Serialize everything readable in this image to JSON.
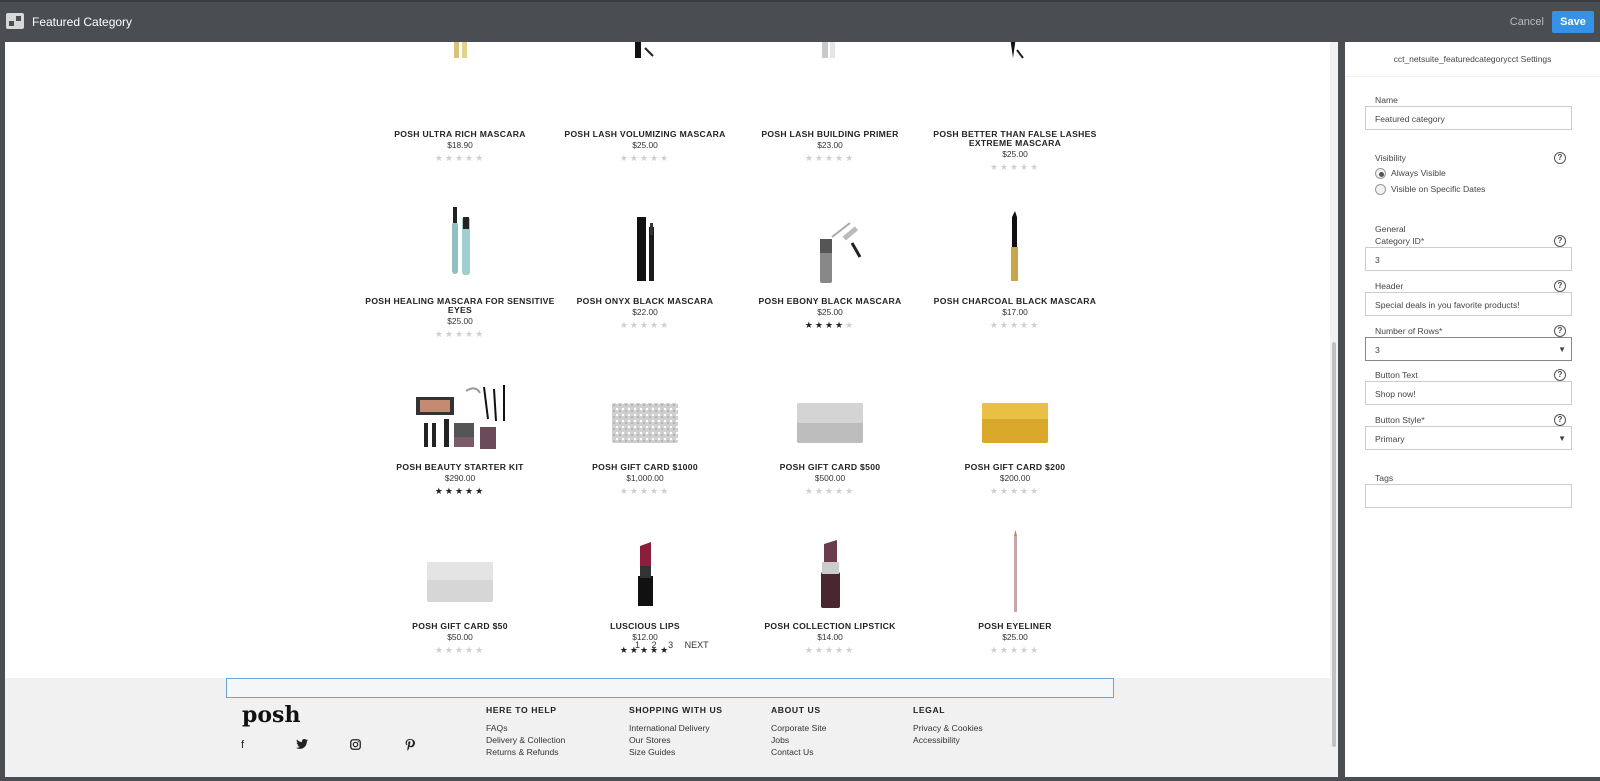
{
  "topbar": {
    "title": "Featured Category",
    "cancel": "Cancel",
    "save": "Save"
  },
  "products": [
    {
      "name": "POSH ULTRA RICH MASCARA",
      "price": "$18.90",
      "rating": 0,
      "img": "mascara-gold"
    },
    {
      "name": "POSH LASH VOLUMIZING MASCARA",
      "price": "$25.00",
      "rating": 0,
      "img": "mascara-black"
    },
    {
      "name": "POSH LASH BUILDING PRIMER",
      "price": "$23.00",
      "rating": 0,
      "img": "primer-silver"
    },
    {
      "name": "POSH BETTER THAN FALSE LASHES EXTREME MASCARA",
      "price": "$25.00",
      "rating": 0,
      "img": "mascara-wand"
    },
    {
      "name": "POSH HEALING MASCARA FOR SENSITIVE EYES",
      "price": "$25.00",
      "rating": 0,
      "img": "mascara-teal"
    },
    {
      "name": "POSH ONYX BLACK MASCARA",
      "price": "$22.00",
      "rating": 0,
      "img": "mascara-onyx"
    },
    {
      "name": "POSH EBONY BLACK MASCARA",
      "price": "$25.00",
      "rating": 4,
      "img": "mascara-ebony"
    },
    {
      "name": "POSH CHARCOAL BLACK MASCARA",
      "price": "$17.00",
      "rating": 0,
      "img": "mascara-charcoal"
    },
    {
      "name": "POSH BEAUTY STARTER KIT",
      "price": "$290.00",
      "rating": 5,
      "img": "starter-kit"
    },
    {
      "name": "POSH GIFT CARD $1000",
      "price": "$1,000.00",
      "rating": 0,
      "img": "card-diamond"
    },
    {
      "name": "POSH GIFT CARD $500",
      "price": "$500.00",
      "rating": 0,
      "img": "card-platinum"
    },
    {
      "name": "POSH GIFT CARD $200",
      "price": "$200.00",
      "rating": 0,
      "img": "card-gold"
    },
    {
      "name": "POSH GIFT CARD $50",
      "price": "$50.00",
      "rating": 0,
      "img": "card-silver"
    },
    {
      "name": "LUSCIOUS LIPS",
      "price": "$12.00",
      "rating": 4.5,
      "img": "lipstick-red"
    },
    {
      "name": "POSH COLLECTION LIPSTICK",
      "price": "$14.00",
      "rating": 0,
      "img": "lipstick-plum"
    },
    {
      "name": "POSH EYELINER",
      "price": "$25.00",
      "rating": 0,
      "img": "pencil"
    }
  ],
  "pager": {
    "p1": "1",
    "p2": "2",
    "p3": "3",
    "next": "NEXT"
  },
  "footer": {
    "logo": "posh",
    "social": [
      "facebook-icon",
      "twitter-icon",
      "instagram-icon",
      "pinterest-icon"
    ],
    "cols": [
      {
        "heading": "HERE TO HELP",
        "links": [
          "FAQs",
          "Delivery & Collection",
          "Returns & Refunds"
        ]
      },
      {
        "heading": "SHOPPING WITH US",
        "links": [
          "International Delivery",
          "Our Stores",
          "Size Guides"
        ]
      },
      {
        "heading": "ABOUT US",
        "links": [
          "Corporate Site",
          "Jobs",
          "Contact Us"
        ]
      },
      {
        "heading": "LEGAL",
        "links": [
          "Privacy & Cookies",
          "Accessibility"
        ]
      }
    ]
  },
  "panel": {
    "title": "cct_netsuite_featuredcategorycct Settings",
    "name_label": "Name",
    "name_value": "Featured category",
    "visibility_label": "Visibility",
    "vis_opt1": "Always Visible",
    "vis_opt2": "Visible on Specific Dates",
    "general_label": "General",
    "catid_label": "Category ID*",
    "catid_value": "3",
    "header_label": "Header",
    "header_value": "Special deals in you favorite products!",
    "rows_label": "Number of Rows*",
    "rows_value": "3",
    "btntext_label": "Button Text",
    "btntext_value": "Shop now!",
    "btnstyle_label": "Button Style*",
    "btnstyle_value": "Primary",
    "tags_label": "Tags",
    "tags_value": ""
  },
  "colors": {
    "save": "#3592e7",
    "topbar": "#4a4d52"
  }
}
